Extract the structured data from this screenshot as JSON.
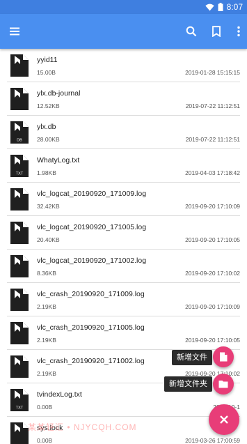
{
  "status": {
    "time": "8:07"
  },
  "toolbar": {
    "menu_icon": "menu-icon",
    "search_icon": "search-icon",
    "bookmark_icon": "bookmark-icon",
    "more_icon": "more-vert-icon"
  },
  "files": [
    {
      "name": "yyid11",
      "size": "15.00B",
      "date": "2019-01-28 15:15:15",
      "badge": ""
    },
    {
      "name": "ylx.db-journal",
      "size": "12.52KB",
      "date": "2019-07-22 11:12:51",
      "badge": ""
    },
    {
      "name": "ylx.db",
      "size": "28.00KB",
      "date": "2019-07-22 11:12:51",
      "badge": "DB"
    },
    {
      "name": "WhatyLog.txt",
      "size": "1.98KB",
      "date": "2019-04-03 17:18:42",
      "badge": "TXT"
    },
    {
      "name": "vlc_logcat_20190920_171009.log",
      "size": "32.42KB",
      "date": "2019-09-20 17:10:09",
      "badge": ""
    },
    {
      "name": "vlc_logcat_20190920_171005.log",
      "size": "20.40KB",
      "date": "2019-09-20 17:10:05",
      "badge": ""
    },
    {
      "name": "vlc_logcat_20190920_171002.log",
      "size": "8.36KB",
      "date": "2019-09-20 17:10:02",
      "badge": ""
    },
    {
      "name": "vlc_crash_20190920_171009.log",
      "size": "2.19KB",
      "date": "2019-09-20 17:10:09",
      "badge": ""
    },
    {
      "name": "vlc_crash_20190920_171005.log",
      "size": "2.19KB",
      "date": "2019-09-20 17:10:05",
      "badge": ""
    },
    {
      "name": "vlc_crash_20190920_171002.log",
      "size": "2.19KB",
      "date": "2019-09-20 17:10:02",
      "badge": ""
    },
    {
      "name": "tvindexLog.txt",
      "size": "0.00B",
      "date": "2019-10-1",
      "badge": "TXT"
    },
    {
      "name": "sys.lock",
      "size": "0.00B",
      "date": "2019-03-26 17:00:59",
      "badge": ""
    }
  ],
  "fab": {
    "new_file_label": "新增文件",
    "new_folder_label": "新增文件夹"
  },
  "watermark": "某某轻汇 • NJYCQH.COM",
  "colors": {
    "statusbar": "#3f7fe0",
    "appbar": "#4a8ff0",
    "fab": "#e83d78"
  }
}
